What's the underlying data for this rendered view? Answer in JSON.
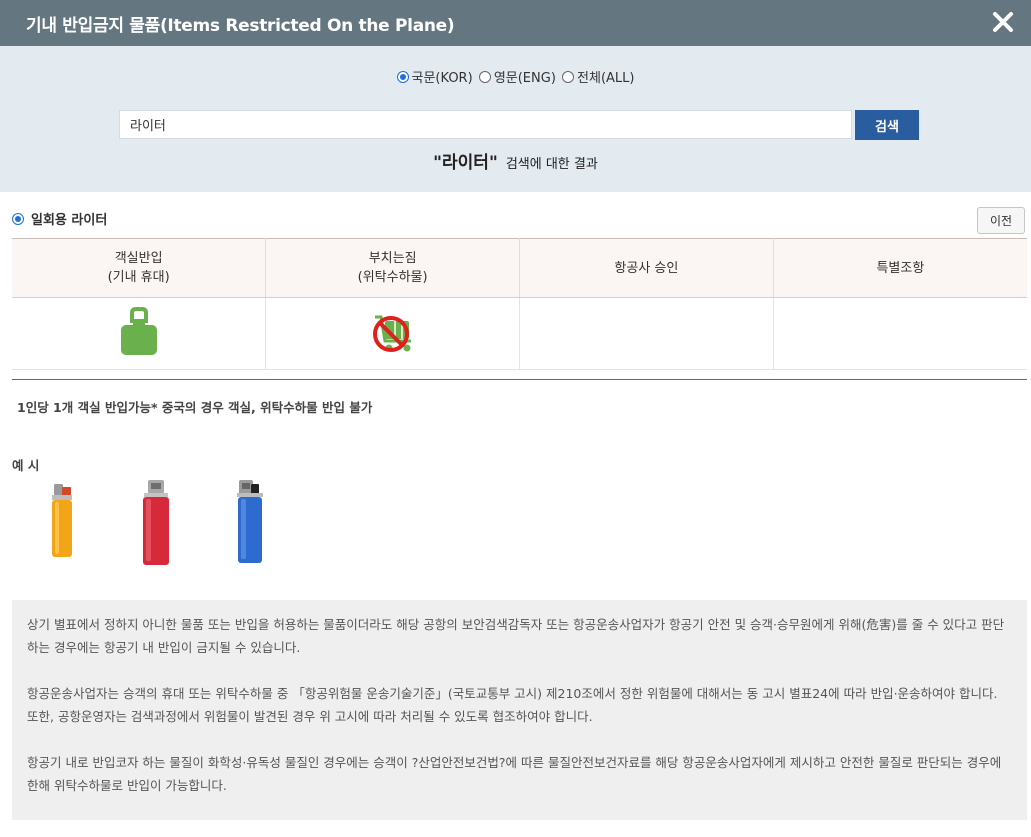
{
  "header": {
    "title": "기내 반입금지 물품(Items Restricted On the Plane)"
  },
  "language": {
    "options": [
      "국문(KOR)",
      "영문(ENG)",
      "전체(ALL)"
    ],
    "selected": "국문(KOR)"
  },
  "search": {
    "value": "라이터",
    "button_label": "검색",
    "result_query": "\"라이터\"",
    "result_suffix": "검색에 대한 결과"
  },
  "item": {
    "name": "일회용 라이터",
    "prev_label": "이전",
    "table": {
      "headers": [
        [
          "객실반입",
          "(기내 휴대)"
        ],
        [
          "부치는짐",
          "(위탁수하물)"
        ],
        [
          "항공사 승인"
        ],
        [
          "특별조항"
        ]
      ],
      "cells": [
        "allowed",
        "forbidden",
        "",
        ""
      ]
    },
    "note": "1인당 1개 객실 반입가능* 중국의 경우 객실, 위탁수하물 반입 불가",
    "example_label": "예 시"
  },
  "colors": {
    "header_bg": "#647680",
    "search_bg": "#e3eaf0",
    "accent": "#2a5da0",
    "allowed_icon": "#6ab04c",
    "forbidden_icon": "#e0201b"
  },
  "notices": [
    "상기 별표에서 정하지 아니한 물품 또는 반입을 허용하는 물품이더라도 해당 공항의 보안검색감독자 또는 항공운송사업자가 항공기 안전 및 승객·승무원에게 위해(危害)를 줄 수 있다고 판단하는 경우에는 항공기 내 반입이 금지될 수 있습니다.",
    "항공운송사업자는 승객의 휴대 또는 위탁수하물 중 「항공위험물 운송기술기준」(국토교통부 고시) 제210조에서 정한 위험물에 대해서는 동 고시 별표24에 따라 반입·운송하여야 합니다. 또한, 공항운영자는 검색과정에서 위험물이 발견된 경우 위 고시에 따라 처리될 수 있도록 협조하여야 합니다.",
    "항공기 내로 반입코자 하는 물질이 화학성·유독성 물질인 경우에는 승객이 ?산업안전보건법?에 따른 물질안전보건자료를 해당 항공운송사업자에게 제시하고 안전한 물질로 판단되는 경우에 한해 위탁수하물로 반입이 가능합니다."
  ]
}
